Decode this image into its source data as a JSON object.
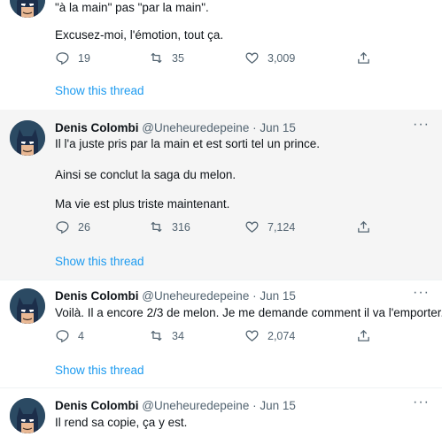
{
  "tweets": [
    {
      "lines": [
        "\"à la main\" pas \"par la main\".",
        "Excusez-moi, l'émotion, tout ça."
      ],
      "reply_count": "19",
      "retweet_count": "35",
      "like_count": "3,009",
      "show_thread": "Show this thread"
    },
    {
      "name": "Denis Colombi",
      "handle": "@Uneheuredepeine",
      "separator": "·",
      "date": "Jun 15",
      "lines": [
        "Il l'a juste pris par la main et est sorti tel un prince.",
        "Ainsi se conclut la saga du melon.",
        "Ma vie est plus triste maintenant."
      ],
      "reply_count": "26",
      "retweet_count": "316",
      "like_count": "7,124",
      "show_thread": "Show this thread"
    },
    {
      "name": "Denis Colombi",
      "handle": "@Uneheuredepeine",
      "separator": "·",
      "date": "Jun 15",
      "lines": [
        "Voilà. Il a encore 2/3 de melon. Je me demande comment il va l'emporter."
      ],
      "reply_count": "4",
      "retweet_count": "34",
      "like_count": "2,074",
      "show_thread": "Show this thread"
    },
    {
      "name": "Denis Colombi",
      "handle": "@Uneheuredepeine",
      "separator": "·",
      "date": "Jun 15",
      "lines": [
        "Il rend sa copie, ça y est."
      ]
    }
  ],
  "more_label": "···",
  "icons": {
    "reply": "reply-icon",
    "retweet": "retweet-icon",
    "like": "like-icon",
    "share": "share-icon",
    "avatar": "batman-avatar"
  },
  "colors": {
    "link": "#1d9bf0",
    "muted": "#536471",
    "highlight_bg": "#f5f5f5"
  }
}
